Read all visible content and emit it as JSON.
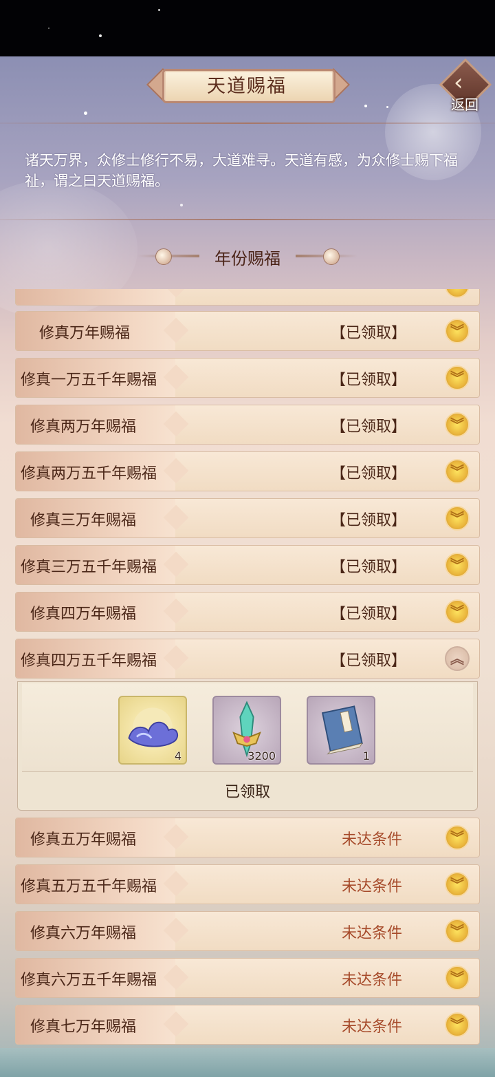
{
  "header": {
    "title": "天道赐福",
    "back_label": "返回"
  },
  "description": "诸天万界，众修士修行不易，大道难寻。天道有感，为众修士赐下福祉，谓之曰天道赐福。",
  "section_title": "年份赐福",
  "rows": [
    {
      "name": "修真万年赐福",
      "status": "【已领取】",
      "state": "claimed"
    },
    {
      "name": "修真一万五千年赐福",
      "status": "【已领取】",
      "state": "claimed"
    },
    {
      "name": "修真两万年赐福",
      "status": "【已领取】",
      "state": "claimed"
    },
    {
      "name": "修真两万五千年赐福",
      "status": "【已领取】",
      "state": "claimed"
    },
    {
      "name": "修真三万年赐福",
      "status": "【已领取】",
      "state": "claimed"
    },
    {
      "name": "修真三万五千年赐福",
      "status": "【已领取】",
      "state": "claimed"
    },
    {
      "name": "修真四万年赐福",
      "status": "【已领取】",
      "state": "claimed"
    },
    {
      "name": "修真四万五千年赐福",
      "status": "【已领取】",
      "state": "claimed",
      "expanded": true
    },
    {
      "name": "修真五万年赐福",
      "status": "未达条件",
      "state": "unmet"
    },
    {
      "name": "修真五万五千年赐福",
      "status": "未达条件",
      "state": "unmet"
    },
    {
      "name": "修真六万年赐福",
      "status": "未达条件",
      "state": "unmet"
    },
    {
      "name": "修真六万五千年赐福",
      "status": "未达条件",
      "state": "unmet"
    },
    {
      "name": "修真七万年赐福",
      "status": "未达条件",
      "state": "unmet"
    }
  ],
  "expanded_detail": {
    "rewards": [
      {
        "icon": "blue-cloud-icon",
        "qty": "4"
      },
      {
        "icon": "jade-sword-icon",
        "qty": "3200"
      },
      {
        "icon": "blue-book-icon",
        "qty": "1"
      }
    ],
    "claimed_label": "已领取"
  },
  "colors": {
    "status_claimed": "#4b2718",
    "status_unmet": "#a64a2a",
    "toggle_gold": "#eab63d"
  }
}
